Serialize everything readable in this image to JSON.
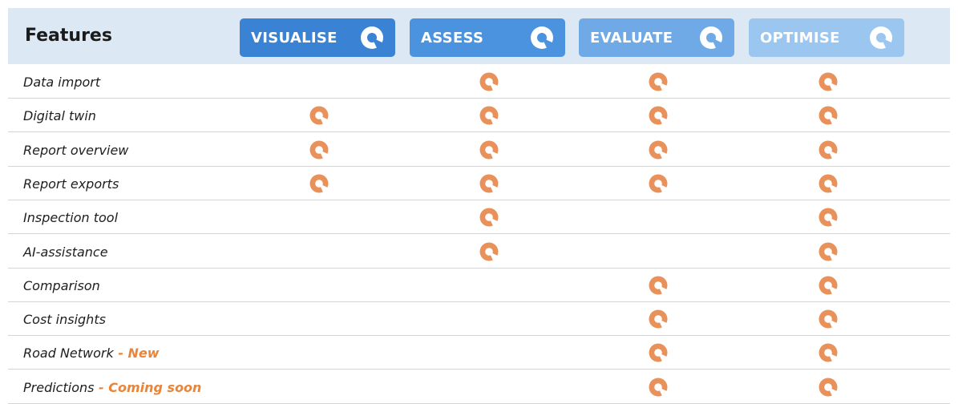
{
  "header": {
    "title": "Features",
    "plans": [
      {
        "id": "visualise",
        "label": "VISUALISE",
        "icon": "brand-q-icon",
        "color": "#3a82d4"
      },
      {
        "id": "assess",
        "label": "ASSESS",
        "icon": "brand-q-icon",
        "color": "#4b93df"
      },
      {
        "id": "evaluate",
        "label": "EVALUATE",
        "icon": "brand-q-icon",
        "color": "#70aae6"
      },
      {
        "id": "optimise",
        "label": "OPTIMISE",
        "icon": "brand-q-icon",
        "color": "#9bc6ef"
      }
    ]
  },
  "check_icon": {
    "name": "brand-q-icon",
    "color": "#e8915a"
  },
  "rows": [
    {
      "label": "Data import",
      "tag": "",
      "included": [
        false,
        true,
        true,
        true
      ]
    },
    {
      "label": "Digital twin",
      "tag": "",
      "included": [
        true,
        true,
        true,
        true
      ]
    },
    {
      "label": "Report overview",
      "tag": "",
      "included": [
        true,
        true,
        true,
        true
      ]
    },
    {
      "label": "Report exports",
      "tag": "",
      "included": [
        true,
        true,
        true,
        true
      ]
    },
    {
      "label": "Inspection tool",
      "tag": "",
      "included": [
        false,
        true,
        false,
        true
      ]
    },
    {
      "label": "AI-assistance",
      "tag": "",
      "included": [
        false,
        true,
        false,
        true
      ]
    },
    {
      "label": "Comparison",
      "tag": "",
      "included": [
        false,
        false,
        true,
        true
      ]
    },
    {
      "label": "Cost insights",
      "tag": "",
      "included": [
        false,
        false,
        true,
        true
      ]
    },
    {
      "label": "Road Network",
      "tag": " - New",
      "included": [
        false,
        false,
        true,
        true
      ]
    },
    {
      "label": "Predictions",
      "tag": " - Coming soon",
      "included": [
        false,
        false,
        true,
        true
      ]
    }
  ]
}
